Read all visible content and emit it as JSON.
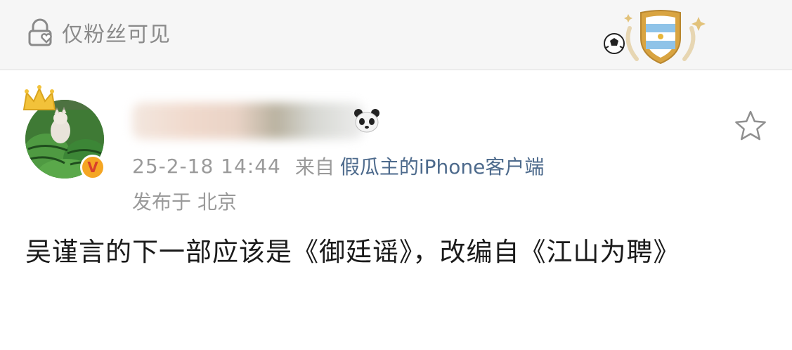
{
  "header": {
    "visibility_label": "仅粉丝可见"
  },
  "post": {
    "timestamp": "25-2-18 14:44",
    "from_label": "来自",
    "source": "假瓜主的iPhone客户端",
    "location": "发布于 北京",
    "content": "吴谨言的下一部应该是《御廷谣》，改编自《江山为聘》"
  },
  "icons": {
    "lock_heart": "lock-heart-icon",
    "star": "star-icon",
    "panda": "panda-emoji-icon",
    "badge": "argentina-shield-badge-icon"
  },
  "colors": {
    "link_blue": "#4d6a8c",
    "meta_gray": "#9a9a9a",
    "vip_orange": "#f5a623"
  }
}
